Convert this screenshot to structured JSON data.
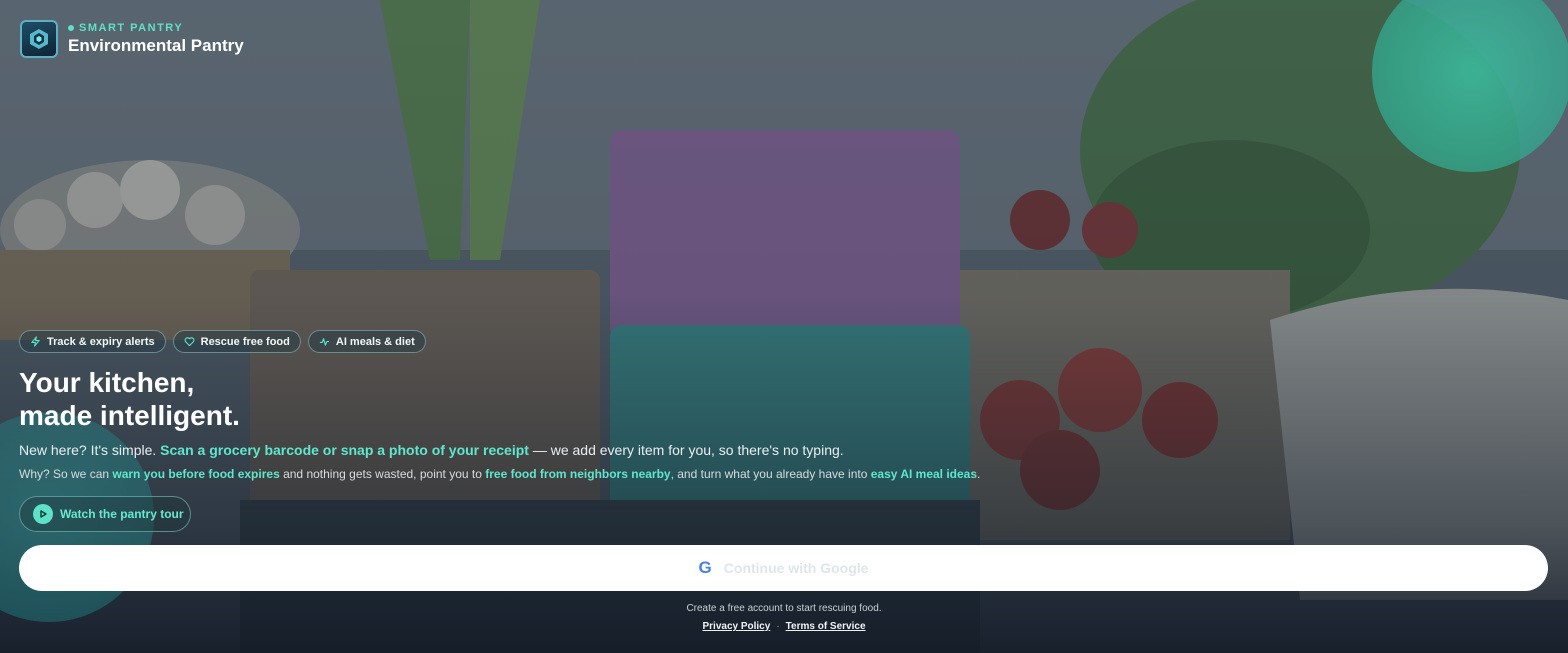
{
  "brand": {
    "kicker": "SMART PANTRY",
    "name": "Environmental Pantry",
    "logo_icon": "cube-shield-icon"
  },
  "chips": [
    {
      "label": "Track & expiry alerts",
      "icon": "bolt-icon"
    },
    {
      "label": "Rescue free food",
      "icon": "heart-icon"
    },
    {
      "label": "AI meals & diet",
      "icon": "activity-icon"
    }
  ],
  "hero": {
    "title_line1": "Your kitchen,",
    "title_line2": "made intelligent.",
    "lead_prefix": "New here? It's simple. ",
    "lead_highlight": "Scan a grocery barcode or snap a photo of your receipt",
    "lead_suffix": " — we add every item for you, so there's no typing.",
    "why_1": "Why? So we can ",
    "why_hl1": "warn you before food expires",
    "why_2": " and nothing gets wasted, point you to ",
    "why_hl2": "free food from neighbors nearby",
    "why_3": ", and turn what you already have into ",
    "why_hl3": "easy AI meal ideas",
    "why_4": "."
  },
  "tour_button": {
    "label": "Watch the pantry tour",
    "icon": "play-icon"
  },
  "google_button": {
    "label": "Continue with Google",
    "icon": "G"
  },
  "footer": {
    "note": "Create a free account to start rescuing food.",
    "privacy": "Privacy Policy",
    "separator": "·",
    "terms": "Terms of Service"
  },
  "colors": {
    "accent": "#5fe6cc",
    "google_blue": "#4a7fe0"
  }
}
